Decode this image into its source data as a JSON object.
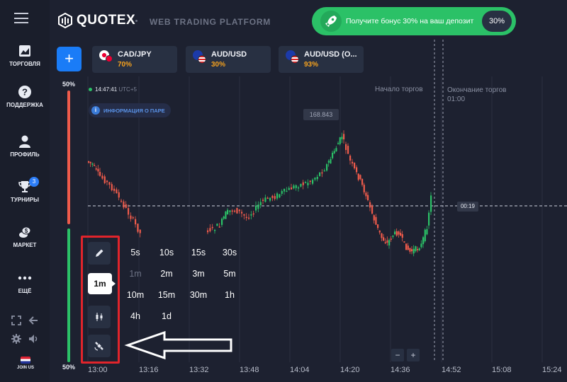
{
  "colors": {
    "background": "#1d2130",
    "sidebar": "#1a1e2b",
    "accent_blue": "#1a7cf7",
    "bonus_green": "#2bc167",
    "payout_orange": "#f6a21e",
    "candle_up": "#2bc167",
    "candle_down": "#ef5b4b",
    "highlight_red": "#e0242b"
  },
  "sidebar": {
    "menu_icon": "hamburger-icon",
    "items": [
      {
        "label": "ТОРГОВЛЯ",
        "icon": "chart-icon"
      },
      {
        "label": "ПОДДЕРЖКА",
        "icon": "help-icon"
      },
      {
        "label": "ПРОФИЛЬ",
        "icon": "user-icon"
      },
      {
        "label": "ТУРНИРЫ",
        "icon": "trophy-icon",
        "badge": "3"
      },
      {
        "label": "МАРКЕТ",
        "icon": "coins-icon"
      },
      {
        "label": "ЕЩЁ",
        "icon": "more-icon"
      }
    ],
    "join_label": "JOIN US"
  },
  "header": {
    "logo": "QUOTEX",
    "platform": "WEB TRADING PLATFORM",
    "bonus_text": "Получите бонус 30% на ваш депозит",
    "bonus_pct": "30%"
  },
  "assets": [
    {
      "name": "CAD/JPY",
      "payout": "70%"
    },
    {
      "name": "AUD/USD",
      "payout": "30%"
    },
    {
      "name": "AUD/USD (O...",
      "payout": "93%"
    }
  ],
  "chart": {
    "clock_time": "14:47:41",
    "clock_tz": "UTC+5",
    "info_label": "ИНФОРМАЦИЯ О ПАРЕ",
    "sentiment_top": "50%",
    "sentiment_bottom": "50%",
    "sentiment_up_fraction": 0.5,
    "start_label": "Начало торгов",
    "end_label": "Окончание торгов",
    "end_time": "01:00",
    "price_label": "168.843",
    "timer_label": "00:19",
    "zoom_out": "−",
    "zoom_in": "+",
    "time_axis": [
      "13:00",
      "13:16",
      "13:32",
      "13:48",
      "14:04",
      "14:20",
      "14:36",
      "14:52",
      "15:08",
      "15:24"
    ]
  },
  "tools": {
    "draw_icon": "pencil-icon",
    "selected_timeframe": "1m",
    "chart_type_icon": "candles-icon",
    "indicators_icon": "satellite-icon",
    "timeframes": [
      [
        "5s",
        "10s",
        "15s",
        "30s"
      ],
      [
        "1m",
        "2m",
        "3m",
        "5m"
      ],
      [
        "10m",
        "15m",
        "30m",
        "1h"
      ],
      [
        "4h",
        "1d"
      ]
    ]
  }
}
